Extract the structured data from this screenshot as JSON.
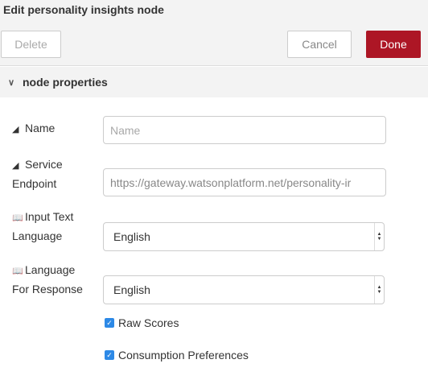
{
  "dialog": {
    "title": "Edit personality insights node"
  },
  "toolbar": {
    "delete_label": "Delete",
    "cancel_label": "Cancel",
    "done_label": "Done"
  },
  "section": {
    "label": "node properties",
    "chevron_icon": "chevron-down-icon"
  },
  "fields": {
    "name": {
      "label": "Name",
      "placeholder": "Name",
      "value": "",
      "icon": "tag-icon"
    },
    "service_endpoint": {
      "label_line1": "Service",
      "label_line2": "Endpoint",
      "value": "https://gateway.watsonplatform.net/personality-ir",
      "icon": "tag-icon"
    },
    "input_language": {
      "label_line1": "Input Text",
      "label_line2": "Language",
      "selected": "English",
      "icon": "language-icon"
    },
    "response_language": {
      "label_line1": "Language",
      "label_line2": "For Response",
      "selected": "English",
      "icon": "language-icon"
    }
  },
  "options": {
    "raw_scores": {
      "label": "Raw Scores",
      "checked": true
    },
    "consumption_preferences": {
      "label": "Consumption Preferences",
      "checked": true
    }
  },
  "colors": {
    "done_button": "#ad1625",
    "checkbox": "#2d89e6",
    "panel_bg": "#f3f3f3"
  }
}
